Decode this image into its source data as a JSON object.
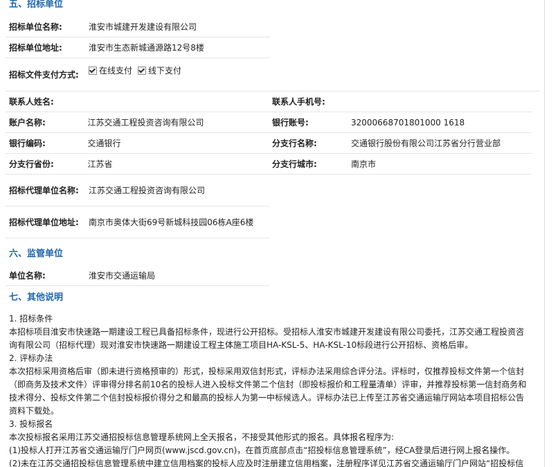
{
  "sections": {
    "s5": "五、招标单位",
    "s6": "六、监管单位",
    "s7": "七、其他说明"
  },
  "tenderer": {
    "name_label": "招标单位名称:",
    "name": "淮安市城建开发建设有限公司",
    "addr_label": "招标单位地址:",
    "addr": "淮安市生态新城通源路12号8楼",
    "pay_label": "招标文件支付方式:",
    "pay_online": "在线支付",
    "pay_offline": "线下支付"
  },
  "contact": {
    "name_label": "联系人姓名:",
    "name": "",
    "phone_label": "联系人手机号:",
    "phone": ""
  },
  "bank": {
    "account_name_label": "账户名称:",
    "account_name": "江苏交通工程投资咨询有限公司",
    "account_no_label": "银行账号:",
    "account_no": "32000668701801000 1618",
    "code_label": "银行编码:",
    "code": "交通银行",
    "branch_label": "分支行名称:",
    "branch": "交通银行股份有限公司江苏省分行营业部",
    "province_label": "分支行省份:",
    "province": "江苏省",
    "city_label": "分支行城市:",
    "city": "南京市"
  },
  "agent": {
    "name_label": "招标代理单位名称:",
    "name": "江苏交通工程投资咨询有限公司",
    "addr_label": "招标代理单位地址:",
    "addr": "南京市奥体大街69号新城科技园06栋A座6楼"
  },
  "supervisor": {
    "name_label": "单位名称:",
    "name": "淮安市交通运输局"
  },
  "other": {
    "l1": "1. 招标条件",
    "l2": "本招标项目淮安市快速路一期建设工程已具备招标条件，现进行公开招标。受招标人淮安市城建开发建设有限公司委托，江苏交通工程投资咨",
    "l3": "询有限公司（招标代理）现对淮安市快速路一期建设工程主体施工项目HA-KSL-5、HA-KSL-10标段进行公开招标、资格后审。",
    "l4": "2. 评标办法",
    "l5": "本次招标采用资格后审（即未进行资格预审的）形式，投标采用双信封形式，评标办法采用综合评分法。评标时，仅推荐投标文件第一个信封",
    "l6": "（即商务及技术文件）评审得分排名前10名的投标人进入投标文件第二个信封（即投标报价和工程量清单）评审，并推荐投标第一信封商务和",
    "l7": "技术得分、投标文件第二个信封投标报价得分之和最高的投标人为第一中标候选人。评标办法已上传至江苏省交通运输厅网站本项目招标公告",
    "l8": "资料下载处。",
    "l9": "3. 投标报名",
    "l10": "本次投标报名采用江苏交通招投标信息管理系统网上全天报名，不接受其他形式的报名。具体报名程序为:",
    "l11": "(1)投标人打开江苏省交通运输厅门户网页(www.jscd.gov.cn)，在首页底部点击“招投标信息管理系统”，经CA登录后进行网上报名操作。",
    "l12": "(2)未在江苏交通招投标信息管理系统中建立信用档案的投标人应及时注册建立信用档案，注册程序详见江苏省交通运输厅门户网站“招投标信"
  }
}
